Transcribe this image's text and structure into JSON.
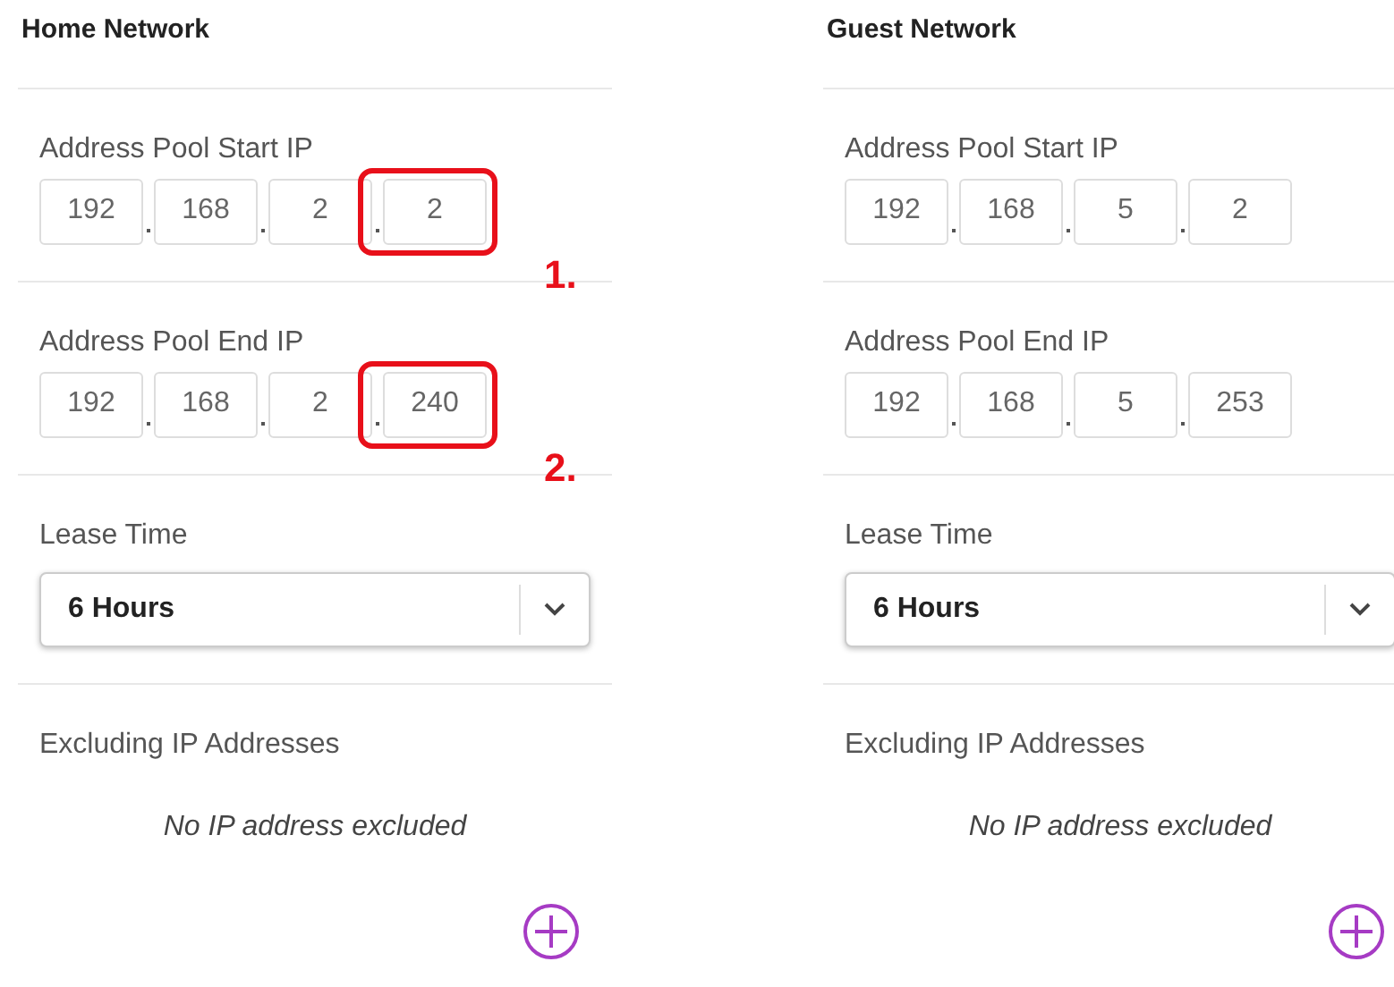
{
  "networks": [
    {
      "title": "Home Network",
      "start_ip": {
        "label": "Address Pool Start IP",
        "octets": [
          {
            "value": "192",
            "highlighted": false
          },
          {
            "value": "168",
            "highlighted": false
          },
          {
            "value": "2",
            "highlighted": false
          },
          {
            "value": "2",
            "highlighted": true
          }
        ],
        "callout": "1."
      },
      "end_ip": {
        "label": "Address Pool End IP",
        "octets": [
          {
            "value": "192",
            "highlighted": false
          },
          {
            "value": "168",
            "highlighted": false
          },
          {
            "value": "2",
            "highlighted": false
          },
          {
            "value": "240",
            "highlighted": true
          }
        ],
        "callout": "2."
      },
      "lease_time": {
        "label": "Lease Time",
        "value": "6 Hours"
      },
      "excluding": {
        "label": "Excluding IP Addresses",
        "empty_text": "No IP address excluded"
      }
    },
    {
      "title": "Guest Network",
      "start_ip": {
        "label": "Address Pool Start IP",
        "octets": [
          {
            "value": "192",
            "highlighted": false
          },
          {
            "value": "168",
            "highlighted": false
          },
          {
            "value": "5",
            "highlighted": false
          },
          {
            "value": "2",
            "highlighted": false
          }
        ]
      },
      "end_ip": {
        "label": "Address Pool End IP",
        "octets": [
          {
            "value": "192",
            "highlighted": false
          },
          {
            "value": "168",
            "highlighted": false
          },
          {
            "value": "5",
            "highlighted": false
          },
          {
            "value": "253",
            "highlighted": false
          }
        ]
      },
      "lease_time": {
        "label": "Lease Time",
        "value": "6 Hours"
      },
      "excluding": {
        "label": "Excluding IP Addresses",
        "empty_text": "No IP address excluded"
      }
    }
  ]
}
